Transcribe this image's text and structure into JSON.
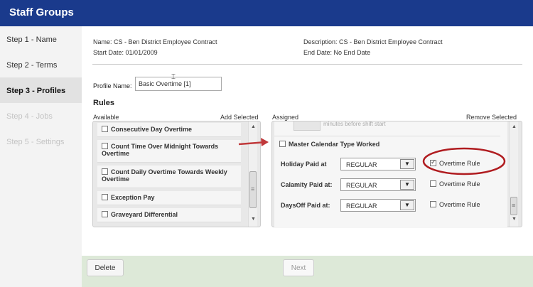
{
  "title": "Staff Groups",
  "steps": [
    {
      "label": "Step 1 - Name",
      "state": "normal"
    },
    {
      "label": "Step 2 - Terms",
      "state": "normal"
    },
    {
      "label": "Step 3 - Profiles",
      "state": "active"
    },
    {
      "label": "Step 4 - Jobs",
      "state": "disabled"
    },
    {
      "label": "Step 5 - Settings",
      "state": "disabled"
    }
  ],
  "info": {
    "name": "Name: CS - Ben District Employee Contract",
    "start_date_label": "Start Date:",
    "start_date": "01/01/2009",
    "description": "Description: CS - Ben District Employee Contract",
    "end_date_label": "End Date:",
    "end_date": "No End Date"
  },
  "profile": {
    "label": "Profile Name:",
    "value": "Basic Overtime [1]"
  },
  "rules": {
    "heading": "Rules",
    "available_label": "Available",
    "add_selected": "Add Selected",
    "assigned_label": "Assigned",
    "remove_selected": "Remove Selected",
    "available_items": [
      "Consecutive Day Overtime",
      "Count Time Over Midnight Towards Overtime",
      "Count Daily Overtime Towards Weekly Overtime",
      "Exception Pay",
      "Graveyard Differential"
    ],
    "assigned_partial_text": "minutes before shift start",
    "assigned_item": "Master Calendar Type Worked",
    "pay_rows": [
      {
        "label": "Holiday Paid at",
        "value": "REGULAR",
        "ot_label": "Overtime Rule",
        "ot_checked": true
      },
      {
        "label": "Calamity Paid at:",
        "value": "REGULAR",
        "ot_label": "Overtime Rule",
        "ot_checked": false
      },
      {
        "label": "DaysOff Paid at:",
        "value": "REGULAR",
        "ot_label": "Overtime Rule",
        "ot_checked": false
      }
    ]
  },
  "buttons": {
    "delete": "Delete",
    "next": "Next"
  },
  "annotation_colors": {
    "arrow": "#c0393b",
    "circle": "#b01c20"
  }
}
